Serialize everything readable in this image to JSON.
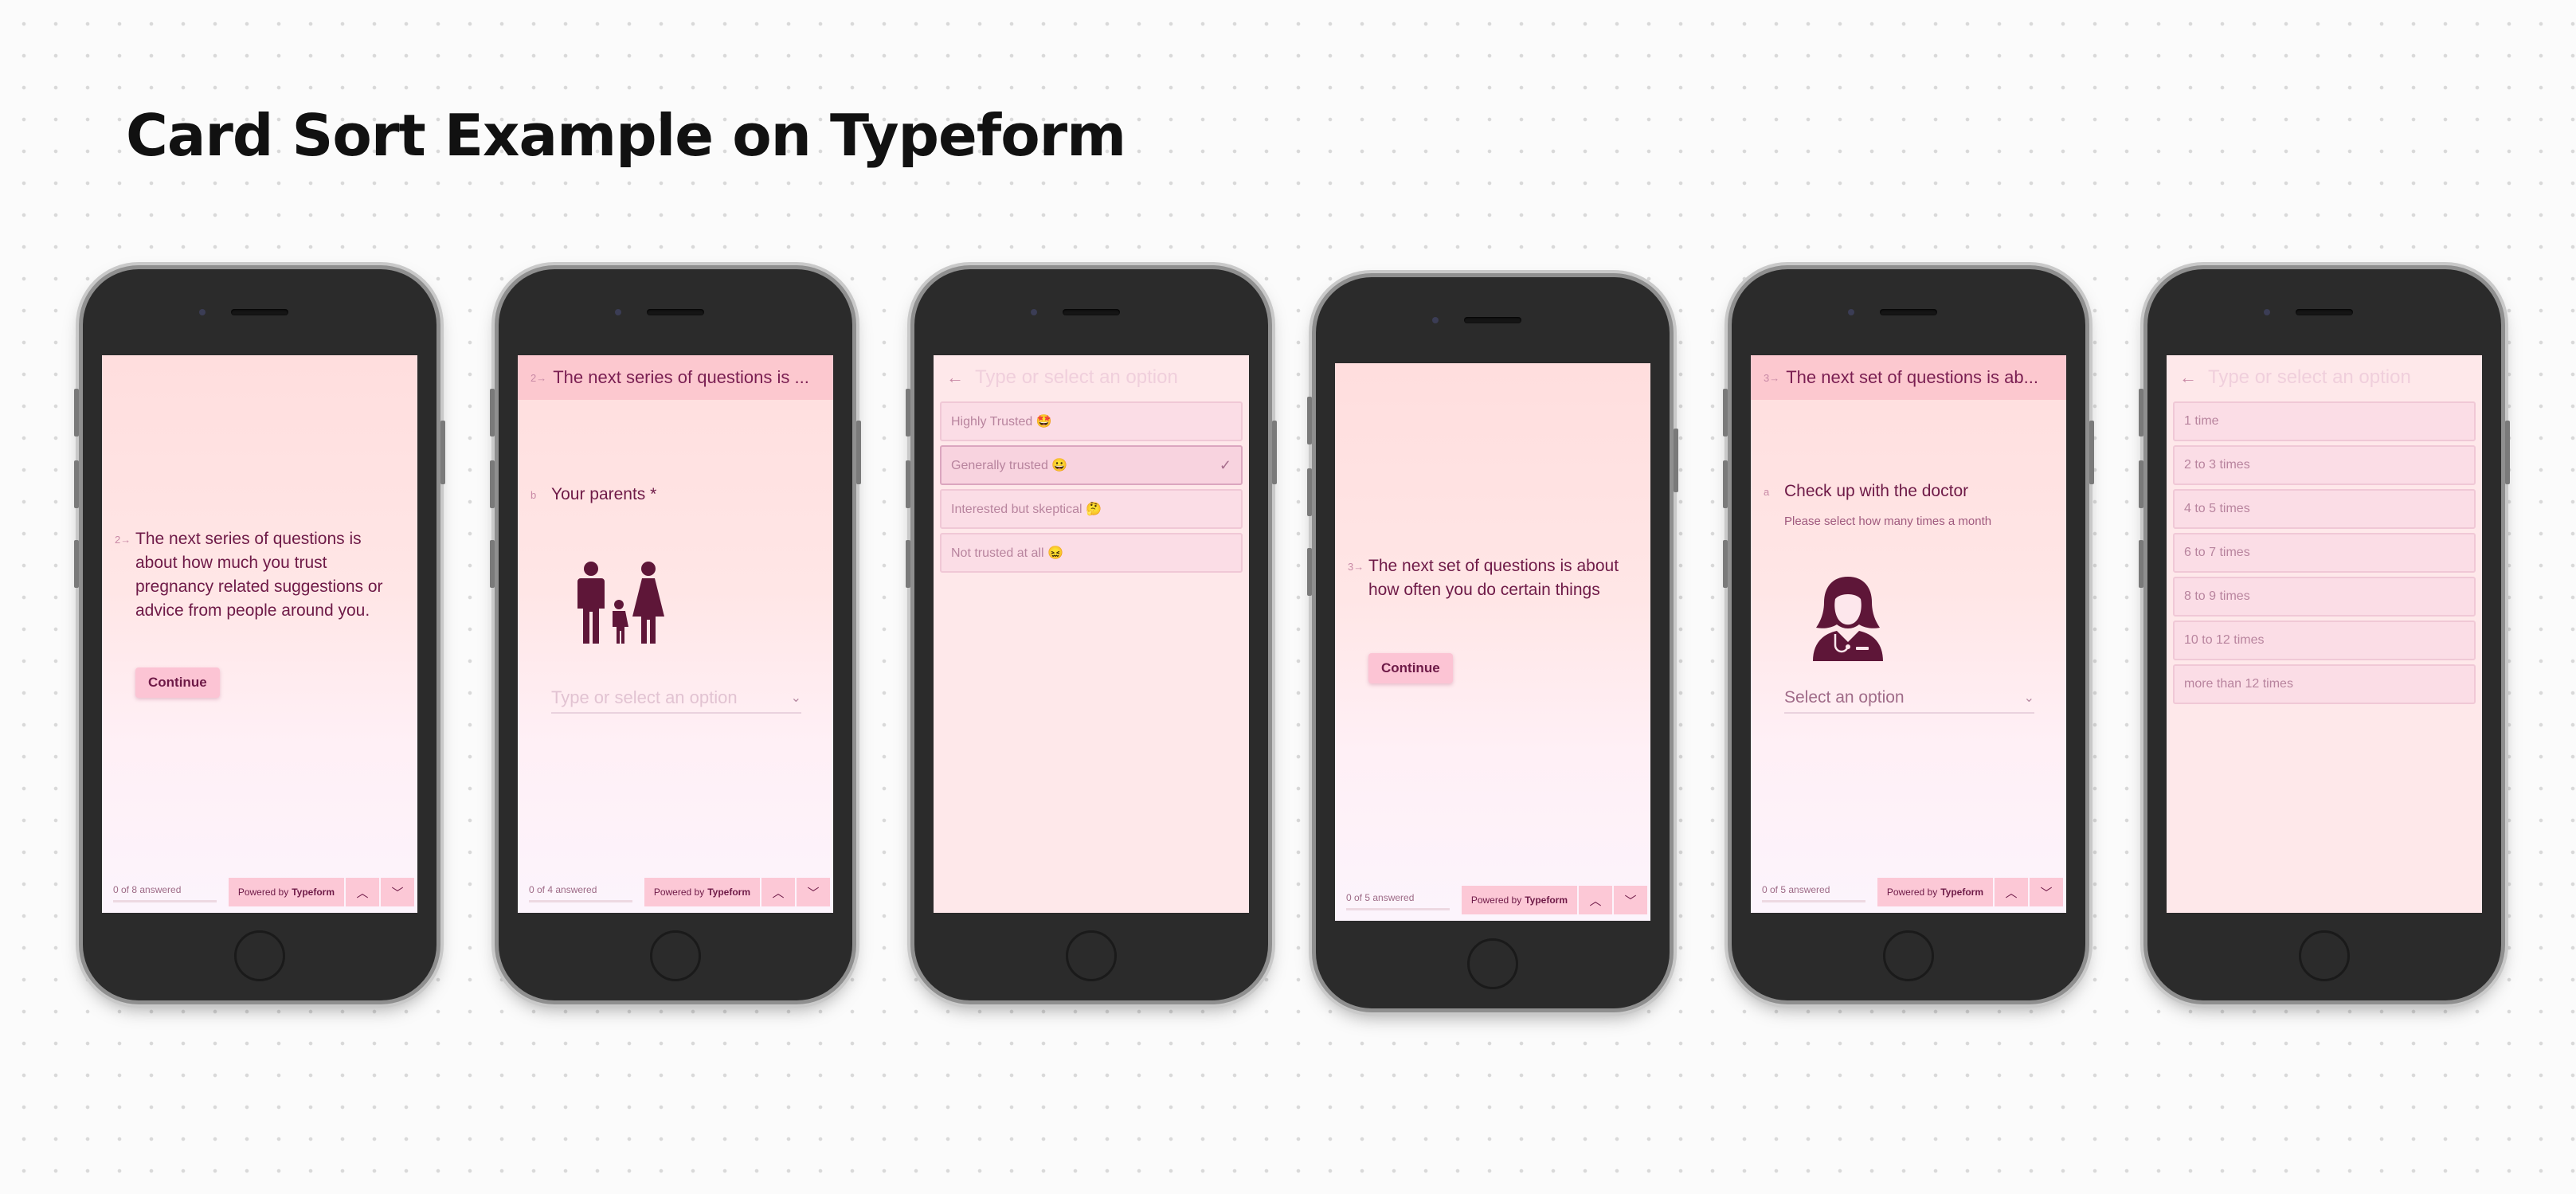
{
  "page_title": "Card Sort Example on Typeform",
  "colors": {
    "brand": "#6e1a47",
    "header": "#fcc8cf",
    "screen_bg": "#ffe6e6"
  },
  "phones": [
    {
      "question_number": "2→",
      "question_text": "The next series of questions is about how much you trust pregnancy related suggestions or advice from people around you.",
      "button_label": "Continue",
      "progress": "0 of 8 answered",
      "powered_by": "Powered by",
      "brand": "Typeform",
      "nav_up_icon": "chevron-up-icon",
      "nav_down_icon": "chevron-down-icon"
    },
    {
      "header_number": "2→",
      "header_text": "The next series of questions is ...",
      "question_number": "b",
      "question_text": "Your parents *",
      "illustration": "family-icon",
      "select_placeholder": "Type or select an option",
      "progress": "0 of 4 answered",
      "powered_by": "Powered by",
      "brand": "Typeform"
    },
    {
      "search_placeholder": "Type or select an option",
      "back_icon": "arrow-left-icon",
      "options": [
        {
          "label": "Highly Trusted 🤩",
          "selected": false
        },
        {
          "label": "Generally trusted 😀",
          "selected": true
        },
        {
          "label": "Interested but skeptical 🤔",
          "selected": false
        },
        {
          "label": "Not trusted at all 😖",
          "selected": false
        }
      ]
    },
    {
      "question_number": "3→",
      "question_text": "The next set of questions is about how often you do certain things",
      "button_label": "Continue",
      "progress": "0 of 5 answered",
      "powered_by": "Powered by",
      "brand": "Typeform"
    },
    {
      "header_number": "3→",
      "header_text": "The next set of questions is ab...",
      "question_number": "a",
      "question_text": "Check up with the doctor",
      "question_sub": "Please select how many times a month",
      "illustration": "doctor-icon",
      "select_placeholder": "Select an option",
      "progress": "0 of 5 answered",
      "powered_by": "Powered by",
      "brand": "Typeform"
    },
    {
      "search_placeholder": "Type or select an option",
      "back_icon": "arrow-left-icon",
      "options": [
        {
          "label": "1 time"
        },
        {
          "label": "2 to 3 times"
        },
        {
          "label": "4 to 5 times"
        },
        {
          "label": "6 to 7 times"
        },
        {
          "label": "8 to 9 times"
        },
        {
          "label": "10 to 12 times"
        },
        {
          "label": "more than 12 times"
        }
      ]
    }
  ]
}
